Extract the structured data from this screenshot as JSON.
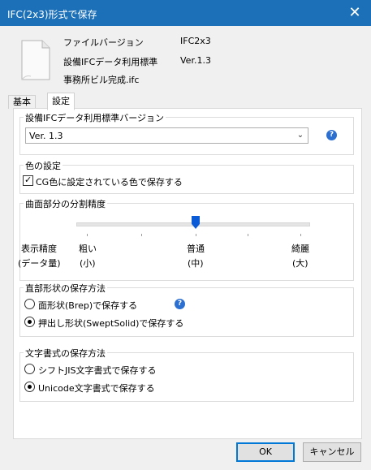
{
  "window": {
    "title": "IFC(2x3)形式で保存",
    "close_label": "✕"
  },
  "file_info": {
    "version_label": "ファイルバージョン",
    "version_value": "IFC2x3",
    "standard_label": "設備IFCデータ利用標準",
    "standard_value": "Ver.1.3",
    "file_name": "事務所ビル完成.ifc"
  },
  "tabs": [
    {
      "label": "基本"
    },
    {
      "label": "設定"
    }
  ],
  "standard_version_group": {
    "title": "設備IFCデータ利用標準バージョン",
    "selected": "Ver. 1.3"
  },
  "color_group": {
    "title": "色の設定",
    "checkbox_label": "CG色に設定されている色で保存する",
    "checked": true
  },
  "precision_group": {
    "title": "曲面部分の分割精度",
    "label_line1": "表示精度",
    "label_line2": "(データ量)",
    "levels": [
      {
        "line1": "粗い",
        "line2": "(小)"
      },
      {
        "line1": "普通",
        "line2": "(中)"
      },
      {
        "line1": "綺麗",
        "line2": "(大)"
      }
    ],
    "selected_level": "普通"
  },
  "shape_group": {
    "title": "直部形状の保存方法",
    "options": [
      {
        "label": "面形状(Brep)で保存する",
        "selected": false
      },
      {
        "label": "押出し形状(SweptSolid)で保存する",
        "selected": true
      }
    ]
  },
  "charset_group": {
    "title": "文字書式の保存方法",
    "options": [
      {
        "label": "シフトJIS文字書式で保存する",
        "selected": false
      },
      {
        "label": "Unicode文字書式で保存する",
        "selected": true
      }
    ]
  },
  "buttons": {
    "ok": "OK",
    "cancel": "キャンセル"
  },
  "icons": {
    "file": "document-icon",
    "help": "help-icon",
    "dropdown": "chevron-down-icon"
  },
  "colors": {
    "titlebar": "#1c70b8",
    "accent": "#0b5ad6"
  }
}
